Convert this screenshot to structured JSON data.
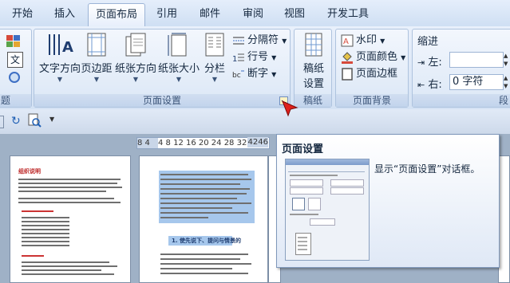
{
  "tabs": [
    "开始",
    "插入",
    "页面布局",
    "引用",
    "邮件",
    "审阅",
    "视图",
    "开发工具"
  ],
  "ribbon": {
    "theme_group_label": "题",
    "page_setup": {
      "label": "页面设置",
      "text_direction": "文字方向",
      "margins": "页边距",
      "orientation": "纸张方向",
      "size": "纸张大小",
      "columns": "分栏",
      "breaks": "分隔符",
      "line_numbers": "行号",
      "hyphenation": "断字"
    },
    "draft": {
      "label": "稿纸",
      "button": "稿纸\n设置",
      "line1": "稿纸",
      "line2": "设置"
    },
    "page_background": {
      "label": "页面背景",
      "watermark": "水印",
      "page_color": "页面颜色",
      "page_borders": "页面边框"
    },
    "paragraph": {
      "indent": "缩进",
      "left_label": "左:",
      "right_label": "右:",
      "right_value": "0 字符",
      "group_label": "段"
    }
  },
  "ruler": {
    "left": "8  4",
    "numbers": "4  8 12 16 20 24 28 32 36",
    "right": "4246"
  },
  "tooltip": {
    "title": "页面设置",
    "description": "显示“页面设置”对话框。"
  },
  "pages": {
    "page1_heading": "组织说明",
    "page2_heading": "1. 使先说下、提问与情景的"
  }
}
